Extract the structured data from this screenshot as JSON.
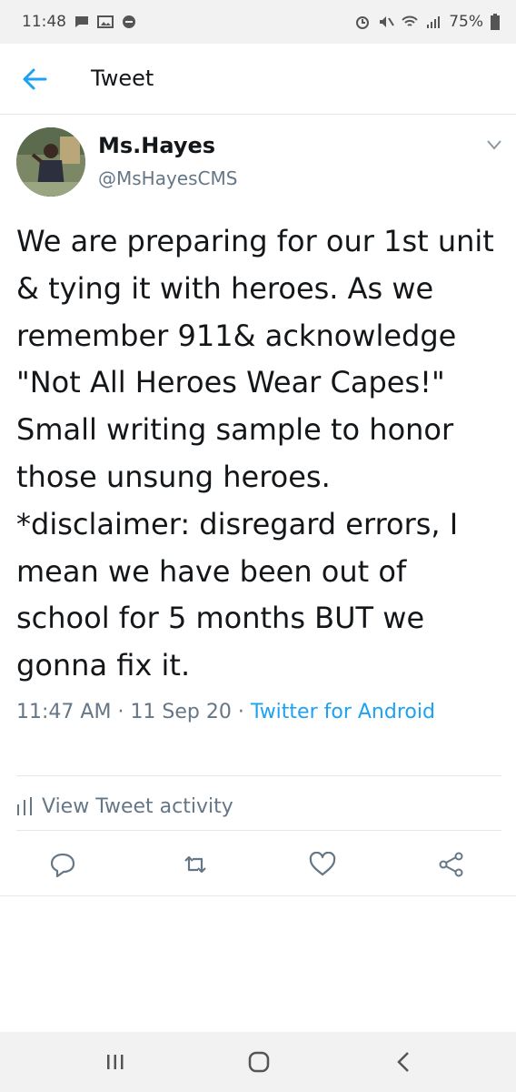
{
  "status_bar": {
    "time": "11:48",
    "battery": "75%",
    "icons": [
      "message-icon",
      "gallery-icon",
      "do-not-disturb-icon",
      "alarm-icon",
      "mute-icon",
      "wifi-icon",
      "signal-icon",
      "battery-icon"
    ]
  },
  "header": {
    "title": "Tweet",
    "back_icon": "arrow-left-icon"
  },
  "author": {
    "name": "Ms.Hayes",
    "handle": "@MsHayesCMS"
  },
  "tweet": {
    "text": "We are preparing for our 1st unit & tying it with heroes. As we remember 911& acknowledge \"Not All Heroes Wear Capes!\" Small writing sample to honor those unsung heroes. *disclaimer: disregard errors, I mean we have been out of school for 5 months BUT we gonna fix it.",
    "time": "11:47 AM",
    "date": "11 Sep 20",
    "source": "Twitter for Android",
    "separator": "·"
  },
  "activity": {
    "label": "View Tweet activity"
  },
  "actions": [
    "reply-icon",
    "retweet-icon",
    "like-icon",
    "share-icon"
  ],
  "colors": {
    "accent": "#1da1f2",
    "secondary_text": "#657786",
    "divider": "#e1e8ed"
  }
}
